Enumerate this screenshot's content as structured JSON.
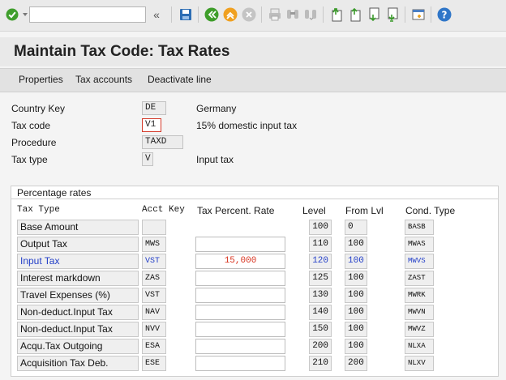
{
  "toolbar": {
    "command_field_value": "",
    "icons": [
      "check-icon",
      "dropdown-icon",
      "collapse-icon",
      "save-icon",
      "back-icon",
      "exit-icon",
      "cancel-icon",
      "print-icon",
      "find-icon",
      "find-next-icon",
      "first-page-icon",
      "previous-page-icon",
      "next-page-icon",
      "last-page-icon",
      "new-session-icon",
      "help-icon"
    ],
    "collapse_glyph": "«"
  },
  "title": "Maintain Tax Code: Tax Rates",
  "app_toolbar": {
    "properties": "Properties",
    "tax_accounts": "Tax accounts",
    "deactivate_line": "Deactivate line"
  },
  "header": {
    "country_key": {
      "label": "Country Key",
      "value": "DE",
      "text": "Germany"
    },
    "tax_code": {
      "label": "Tax code",
      "value": "V1",
      "text": "15% domestic input tax"
    },
    "procedure": {
      "label": "Procedure",
      "value": "TAXD"
    },
    "tax_type": {
      "label": "Tax type",
      "value": "V",
      "text": "Input tax"
    }
  },
  "rates": {
    "group_title": "Percentage rates",
    "columns": {
      "tax_type": "Tax Type",
      "acct_key": "Acct Key",
      "rate": "Tax Percent. Rate",
      "level": "Level",
      "from_lvl": "From Lvl",
      "cond_type": "Cond. Type"
    },
    "rows": [
      {
        "tax_type": "Base Amount",
        "acct_key": "",
        "rate": "",
        "level": "100",
        "from_lvl": "0",
        "cond_type": "BASB",
        "rate_field": false
      },
      {
        "tax_type": "Output Tax",
        "acct_key": "MWS",
        "rate": "",
        "level": "110",
        "from_lvl": "100",
        "cond_type": "MWAS",
        "rate_field": true
      },
      {
        "tax_type": "Input Tax",
        "acct_key": "VST",
        "rate": "15,000",
        "level": "120",
        "from_lvl": "100",
        "cond_type": "MWVS",
        "rate_field": true,
        "highlight": true
      },
      {
        "tax_type": "Interest markdown",
        "acct_key": "ZAS",
        "rate": "",
        "level": "125",
        "from_lvl": "100",
        "cond_type": "ZAST",
        "rate_field": true
      },
      {
        "tax_type": "Travel Expenses (%)",
        "acct_key": "VST",
        "rate": "",
        "level": "130",
        "from_lvl": "100",
        "cond_type": "MWRK",
        "rate_field": true
      },
      {
        "tax_type": "Non-deduct.Input Tax",
        "acct_key": "NAV",
        "rate": "",
        "level": "140",
        "from_lvl": "100",
        "cond_type": "MWVN",
        "rate_field": true
      },
      {
        "tax_type": "Non-deduct.Input Tax",
        "acct_key": "NVV",
        "rate": "",
        "level": "150",
        "from_lvl": "100",
        "cond_type": "MWVZ",
        "rate_field": true
      },
      {
        "tax_type": "Acqu.Tax Outgoing",
        "acct_key": "ESA",
        "rate": "",
        "level": "200",
        "from_lvl": "100",
        "cond_type": "NLXA",
        "rate_field": true
      },
      {
        "tax_type": "Acquisition Tax Deb.",
        "acct_key": "ESE",
        "rate": "",
        "level": "210",
        "from_lvl": "200",
        "cond_type": "NLXV",
        "rate_field": true
      }
    ]
  },
  "colors": {
    "highlight_text": "#2440c8",
    "rate_value": "#d8321e",
    "selection_border": "#d43a2a"
  }
}
